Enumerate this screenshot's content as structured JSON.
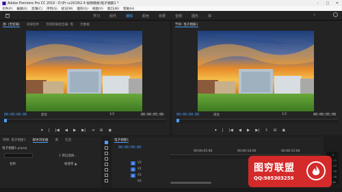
{
  "window": {
    "title": "Adobe Premiere Pro CC 2019 - D:\\Pr cc2019\\2.4 视频模板\\电子相册1 *",
    "minimize": "–",
    "maximize": "□",
    "close": "✕"
  },
  "menu": [
    "文件(F)",
    "编辑(E)",
    "剪辑(C)",
    "序列(S)",
    "标记(M)",
    "图形(G)",
    "视图(V)",
    "窗口(W)",
    "帮助(H)"
  ],
  "workspaces": {
    "items": [
      "学习",
      "组件",
      "编辑",
      "颜色",
      "效果",
      "音频",
      "图形",
      "库"
    ],
    "active_index": 2,
    "more": "»"
  },
  "source_panel": {
    "tabs": [
      "源: (无剪辑)",
      "效果控件",
      "音频剪辑混合器: 电",
      "元数据"
    ],
    "active_index": 0,
    "timecode_left": "00:00:00:00",
    "fit_label": "适合",
    "fraction": "1/2",
    "timecode_right": "00:00:05:00"
  },
  "program_panel": {
    "tabs": [
      "节目: 电子相册1"
    ],
    "active_index": 0,
    "timecode_left": "00:00:00:00",
    "fit_label": "适合",
    "fraction": "1/2",
    "timecode_right": "00:00:05:00"
  },
  "project_panel": {
    "tabs": [
      "项目: 电子相册1",
      "媒体浏览器",
      "库",
      "信息"
    ],
    "active_index": 0,
    "project_file": "电子相册1.prproj",
    "items_count": "1 项已选择...",
    "column_name": "名称",
    "column_framerate": "帧速率 ▲"
  },
  "timeline_panel": {
    "tab": "电子相册1",
    "timecode": "00:00:00:00",
    "ruler_labels": [
      "00:00:05:00",
      "00:00:10:00",
      "00:00:15:00"
    ],
    "tracks": [
      "V2",
      "V1",
      "A1",
      "A2"
    ]
  },
  "watermark": {
    "title": "图穷联盟",
    "subtitle": "QQ:985303259"
  },
  "meter_labels": [
    "0",
    "-12",
    "-24",
    "-36",
    "-48",
    "dB"
  ],
  "colors": {
    "accent": "#4a9fff",
    "panel_bg": "#232323",
    "watermark_red": "#d52a2a"
  }
}
